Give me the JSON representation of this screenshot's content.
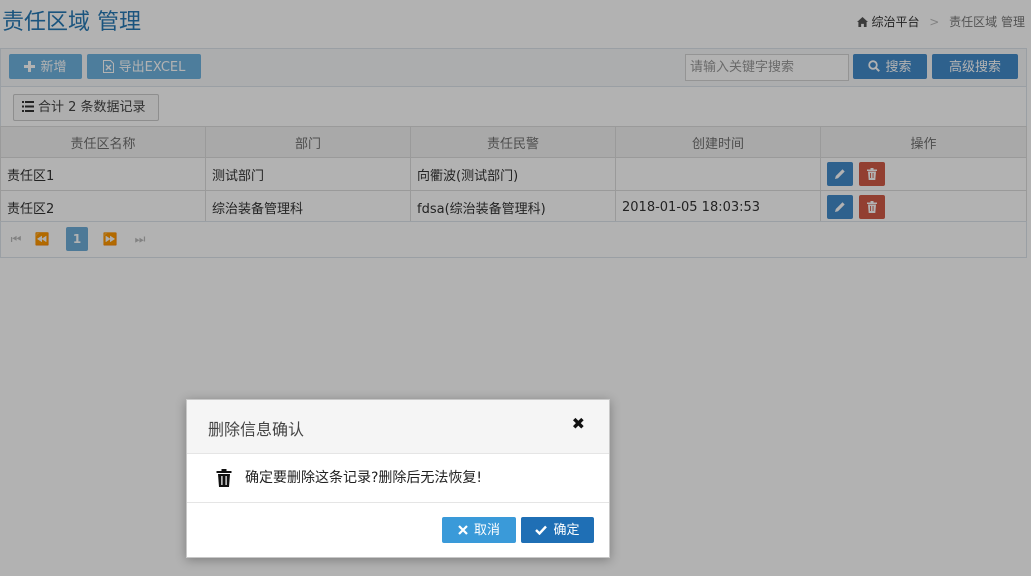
{
  "header": {
    "title": "责任区域 管理",
    "breadcrumb": {
      "home_label": "综治平台",
      "current_label": "责任区域 管理"
    }
  },
  "toolbar": {
    "add_label": "新增",
    "export_label": "导出EXCEL",
    "search_placeholder": "请输入关键字搜索",
    "search_label": "搜索",
    "advanced_search_label": "高级搜索"
  },
  "summary": {
    "count_text": "合计 2 条数据记录"
  },
  "table": {
    "columns": [
      "责任区名称",
      "部门",
      "责任民警",
      "创建时间",
      "操作"
    ],
    "rows": [
      {
        "name": "责任区1",
        "dept": "测试部门",
        "officer": "向衢波(测试部门)",
        "created": ""
      },
      {
        "name": "责任区2",
        "dept": "综治装备管理科",
        "officer": "fdsa(综治装备管理科)",
        "created": "2018-01-05 18:03:53"
      }
    ]
  },
  "pager": {
    "current_page": "1"
  },
  "dialog": {
    "title": "删除信息确认",
    "message": "确定要删除这条记录?删除后无法恢复!",
    "cancel_label": "取消",
    "confirm_label": "确定"
  },
  "icons": {
    "plus": "plus-icon",
    "excel": "file-excel-icon",
    "search": "search-icon",
    "list": "list-icon",
    "edit": "pencil-icon",
    "delete": "trash-icon",
    "home": "home-icon",
    "close": "close-icon",
    "check": "check-icon",
    "cancel": "times-icon"
  },
  "colors": {
    "primary": "#428bca",
    "info": "#6fb3e0",
    "danger": "#d15b47",
    "title": "#2679b5"
  }
}
